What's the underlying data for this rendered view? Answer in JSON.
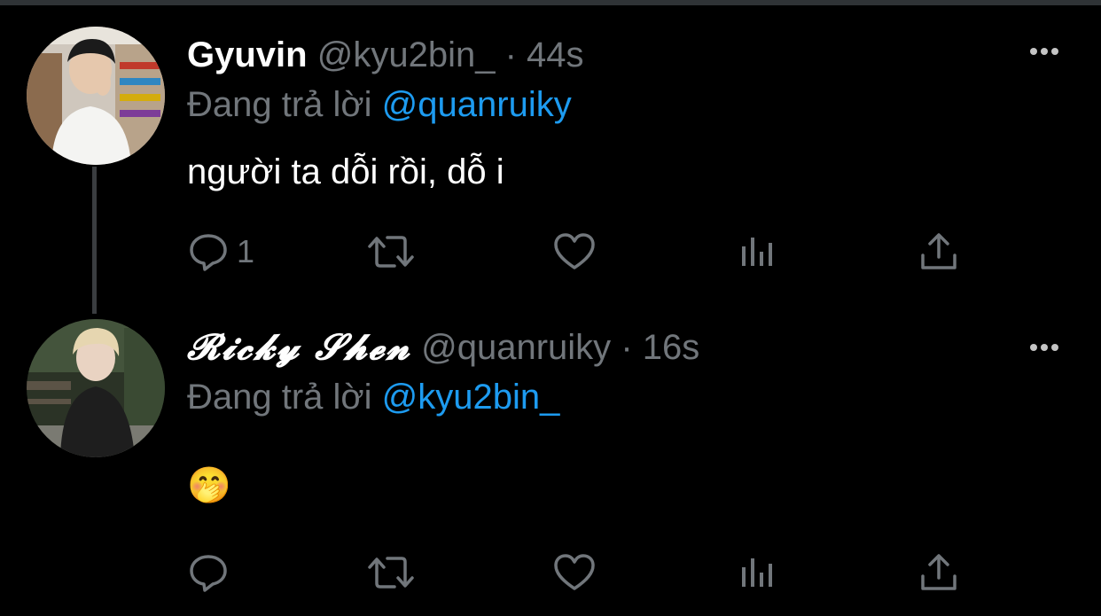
{
  "colors": {
    "background": "#000000",
    "text_primary": "#ffffff",
    "text_secondary": "#71767b",
    "mention": "#1d9bf0",
    "thread_line": "#3a3d40"
  },
  "tweets": [
    {
      "name": "Gyuvin",
      "handle": "@kyu2bin_",
      "separator": "·",
      "time": "44s",
      "reply_prefix": "Đang trả lời",
      "reply_to": "@quanruiky",
      "text": "người ta dỗi rồi, dỗ i",
      "reply_count": "1",
      "icons": [
        "more-dots-icon",
        "reply-icon",
        "retweet-icon",
        "like-heart-icon",
        "views-chart-icon",
        "share-icon"
      ]
    },
    {
      "name": "𝓡𝓲𝓬𝓴𝔂 𝓢𝓱𝓮𝓷",
      "handle": "@quanruiky",
      "separator": "·",
      "time": "16s",
      "reply_prefix": "Đang trả lời",
      "reply_to": "@kyu2bin_",
      "text": "🤭",
      "reply_count": "",
      "icons": [
        "more-dots-icon",
        "reply-icon",
        "retweet-icon",
        "like-heart-icon",
        "views-chart-icon",
        "share-icon"
      ]
    }
  ]
}
